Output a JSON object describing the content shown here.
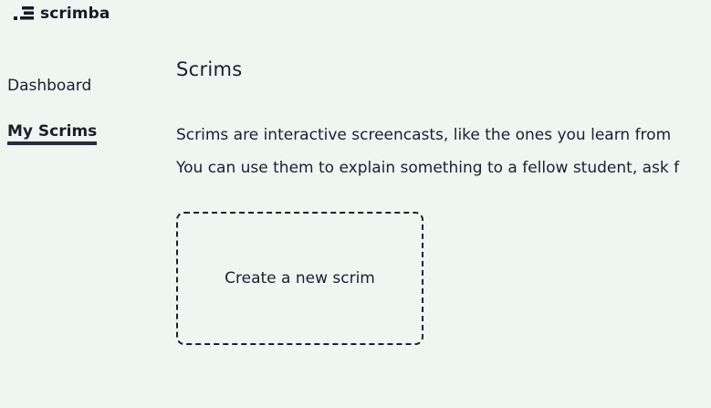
{
  "brand": {
    "name": "scrimba",
    "logo_icon": "scrimba-logo-icon"
  },
  "sidebar": {
    "items": [
      {
        "label": "Dashboard",
        "active": false
      },
      {
        "label": "My Scrims",
        "active": true
      }
    ]
  },
  "main": {
    "title": "Scrims",
    "description_lines": [
      "Scrims are interactive screencasts, like the ones you learn from",
      "You can use them to explain something to a fellow student, ask f"
    ],
    "create_card": {
      "label": "Create a new scrim"
    }
  },
  "colors": {
    "background": "#eff6f2",
    "text": "#1c1f2a",
    "active_underline": "#2a2d3c"
  }
}
